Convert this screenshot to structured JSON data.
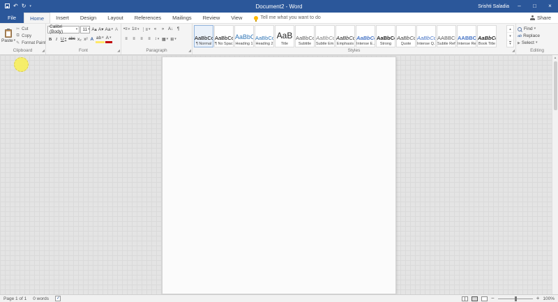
{
  "icons": {
    "caret": "▾",
    "up": "▴",
    "undo": "↶",
    "redo": "↻",
    "minimize": "–",
    "maximize": "□",
    "close": "×"
  },
  "titlebar": {
    "title": "Document2 - Word",
    "user": "Srishti Saladia"
  },
  "tabs": {
    "file": "File",
    "items": [
      "Home",
      "Insert",
      "Design",
      "Layout",
      "References",
      "Mailings",
      "Review",
      "View"
    ],
    "active": "Home",
    "tell_me": "Tell me what you want to do",
    "share": "Share"
  },
  "ribbon": {
    "clipboard": {
      "label": "Clipboard",
      "paste": "Paste",
      "items": [
        {
          "glyph": "✂",
          "label": "Cut",
          "name": "cut-button"
        },
        {
          "glyph": "⧉",
          "label": "Copy",
          "name": "copy-button"
        },
        {
          "glyph": "✎",
          "label": "Format Painter",
          "name": "format-painter-button"
        }
      ]
    },
    "font": {
      "label": "Font",
      "font_name": "Calibri (Body)",
      "font_size": "11",
      "row1_buttons": [
        {
          "glyph": "A▴",
          "name": "grow-font-button"
        },
        {
          "glyph": "A▾",
          "name": "shrink-font-button"
        },
        {
          "glyph": "Aa",
          "name": "change-case-button",
          "caret": true
        },
        {
          "glyph": "A",
          "name": "clear-formatting-button",
          "cls": "clr"
        }
      ],
      "row2_buttons": [
        {
          "glyph": "B",
          "name": "bold-button",
          "cls": "bld"
        },
        {
          "glyph": "I",
          "name": "italic-button",
          "cls": "itl"
        },
        {
          "glyph": "U",
          "name": "underline-button",
          "cls": "und",
          "caret": true
        },
        {
          "glyph": "abc",
          "name": "strikethrough-button",
          "cls": "stk"
        },
        {
          "glyph": "x₂",
          "name": "subscript-button"
        },
        {
          "glyph": "x²",
          "name": "superscript-button"
        },
        {
          "glyph": "A",
          "name": "text-effects-button",
          "cls": "fx"
        },
        {
          "glyph": "ab",
          "name": "highlight-button",
          "cls": "hl",
          "caret": true
        },
        {
          "glyph": "A",
          "name": "font-color-button",
          "cls": "fc",
          "caret": true
        }
      ]
    },
    "paragraph": {
      "label": "Paragraph",
      "row1_buttons": [
        {
          "glyph": "•≡",
          "name": "bullets-button",
          "caret": true
        },
        {
          "glyph": "1≡",
          "name": "numbering-button",
          "caret": true
        },
        {
          "glyph": "⋮≡",
          "name": "multilevel-list-button",
          "caret": true
        },
        {
          "glyph": "«",
          "name": "decrease-indent-button"
        },
        {
          "glyph": "»",
          "name": "increase-indent-button"
        },
        {
          "glyph": "A↓",
          "name": "sort-button"
        },
        {
          "glyph": "¶",
          "name": "show-hide-pilcrow-button"
        }
      ],
      "row2_buttons": [
        {
          "glyph": "≡",
          "name": "align-left-button"
        },
        {
          "glyph": "≡",
          "name": "align-center-button"
        },
        {
          "glyph": "≡",
          "name": "align-right-button"
        },
        {
          "glyph": "≡",
          "name": "justify-button"
        },
        {
          "glyph": "↕",
          "name": "line-spacing-button",
          "caret": true
        },
        {
          "glyph": "▦",
          "name": "shading-button",
          "caret": true
        },
        {
          "glyph": "⊞",
          "name": "borders-button",
          "caret": true
        }
      ]
    },
    "styles": {
      "label": "Styles",
      "items": [
        {
          "preview": "AaBbCcDc",
          "name": "¶ Normal",
          "color": "#000000",
          "selected": true
        },
        {
          "preview": "AaBbCcDc",
          "name": "¶ No Spac...",
          "color": "#000000"
        },
        {
          "preview": "AaBbCc",
          "name": "Heading 1",
          "color": "#2e74b5",
          "size": "lg"
        },
        {
          "preview": "AaBbCcC",
          "name": "Heading 2",
          "color": "#2e74b5"
        },
        {
          "preview": "AaB",
          "name": "Title",
          "color": "#212121",
          "size": "xl"
        },
        {
          "preview": "AaBbCcD",
          "name": "Subtitle",
          "color": "#5a5a5a"
        },
        {
          "preview": "AaBbCcDc",
          "name": "Subtle Em...",
          "color": "#7f7f7f",
          "italic": true
        },
        {
          "preview": "AaBbCcDc",
          "name": "Emphasis",
          "color": "#212121",
          "italic": true
        },
        {
          "preview": "AaBbCcDc",
          "name": "Intense E...",
          "color": "#4472c4",
          "italic": true,
          "bold": true
        },
        {
          "preview": "AaBbCcDc",
          "name": "Strong",
          "color": "#212121",
          "bold": true
        },
        {
          "preview": "AaBbCcDc",
          "name": "Quote",
          "color": "#404040",
          "italic": true
        },
        {
          "preview": "AaBbCcDc",
          "name": "Intense Q...",
          "color": "#4472c4",
          "italic": true
        },
        {
          "preview": "AABBCCDC",
          "name": "Subtle Ref...",
          "color": "#5a5a5a"
        },
        {
          "preview": "AABBCCDC",
          "name": "Intense Re...",
          "color": "#4472c4",
          "bold": true
        },
        {
          "preview": "AaBbCcDc",
          "name": "Book Title",
          "color": "#212121",
          "bold": true,
          "italic": true
        }
      ]
    },
    "editing": {
      "label": "Editing",
      "items": [
        {
          "label": "Find",
          "name": "find-button",
          "icon": "find",
          "caret": true
        },
        {
          "label": "Replace",
          "name": "replace-button",
          "icon": "replace"
        },
        {
          "label": "Select",
          "name": "select-button",
          "icon": "select",
          "caret": true
        }
      ]
    }
  },
  "status": {
    "page": "Page 1 of 1",
    "words": "0 words",
    "zoom": "100%"
  }
}
